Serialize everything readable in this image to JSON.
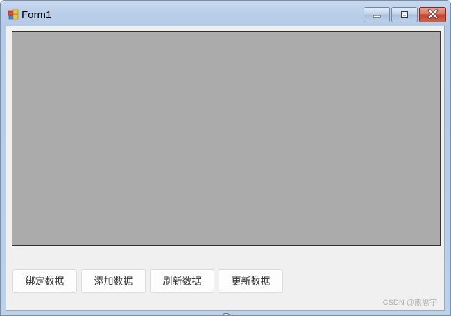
{
  "window": {
    "title": "Form1",
    "icon": "windows-forms-app-icon",
    "controls": {
      "minimize": "minimize-icon",
      "maximize": "maximize-icon",
      "close": "close-icon"
    }
  },
  "grid": {
    "background_color": "#ababab",
    "border_color": "#333333"
  },
  "buttons": [
    {
      "label": "绑定数据"
    },
    {
      "label": "添加数据"
    },
    {
      "label": "刷新数据"
    },
    {
      "label": "更新数据"
    }
  ],
  "watermark": "CSDN @熊思宇",
  "colors": {
    "client_background": "#f0f0f0",
    "close_button": "#c2422d",
    "titlebar": "#b9cfe9"
  }
}
